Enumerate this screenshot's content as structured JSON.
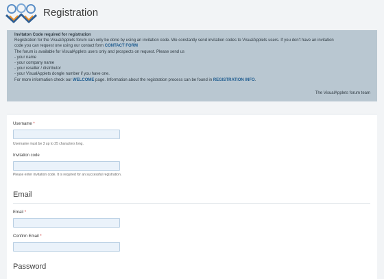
{
  "header": {
    "title": "Registration"
  },
  "notice": {
    "heading": "Invitaton Code required for registration",
    "line1": "Registration for the VisualApplets forum can only be done by using an invitation code. We constantly send invitation codes to VisualApplets users. If you don't have an invitation",
    "line2_pre": "code you can request one using our contact form ",
    "line2_link": "CONTACT FORM",
    "line3": "The forum is available for VisualApplets users only and prospects on request. Please send us",
    "list": [
      "- your name",
      "- your company name",
      "- your reseller / distributor",
      "- your VisualApplets dongle number if you have one."
    ],
    "line_more_pre": "For more information check our ",
    "line_more_link1": "WELCOME",
    "line_more_mid": " page. Information about the registration process can be found in ",
    "line_more_link2": "REGISTRATION INFO",
    "line_more_post": ".",
    "signature": "The VisualApplets forum team"
  },
  "form": {
    "username_label": "Username",
    "username_required": "*",
    "username_value": "",
    "username_hint": "Username must be 3 up to 25 characters long.",
    "invitation_label": "Invitation code",
    "invitation_value": "",
    "invitation_hint": "Please enter invitation code. It is required for an successful registration.",
    "email_section": "Email",
    "email_label": "Email",
    "email_required": "*",
    "email_value": "",
    "confirm_email_label": "Confirm Email",
    "confirm_email_required": "*",
    "confirm_email_value": "",
    "password_section": "Password"
  },
  "colors": {
    "notice_bg": "#b9c7d1",
    "link": "#1d5b8f",
    "required": "#d23a3a",
    "input_bg": "#eaf2fa"
  }
}
